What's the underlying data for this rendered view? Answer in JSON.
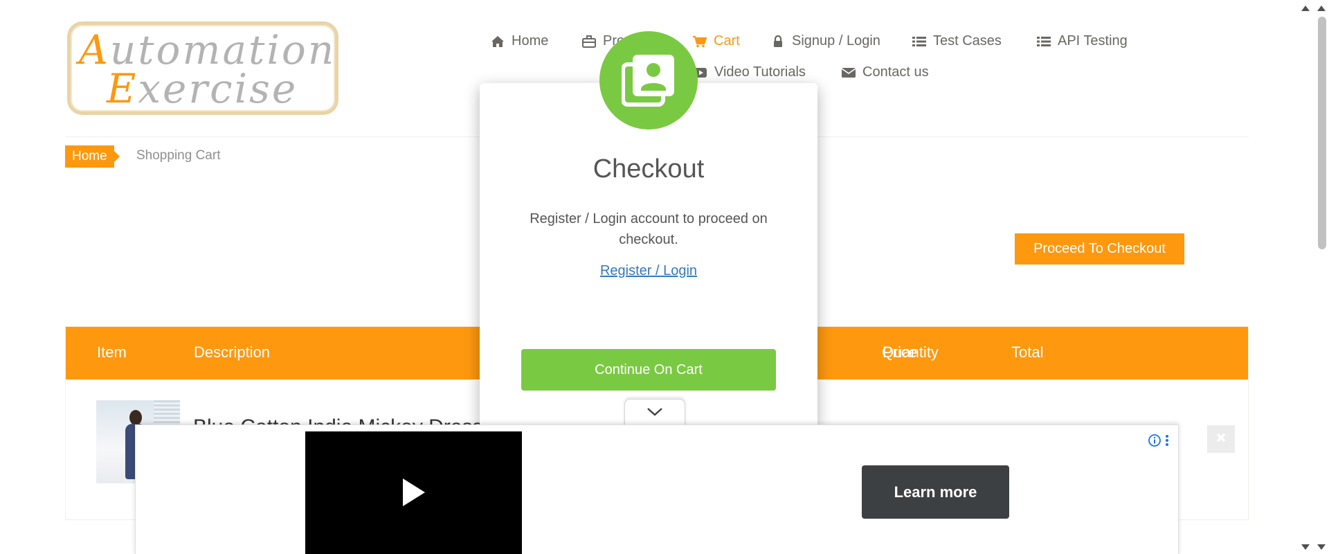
{
  "logo": {
    "line1_first": "A",
    "line1_rest": "utomation",
    "line2_first": "E",
    "line2_rest": "xercise"
  },
  "nav": {
    "items": [
      {
        "label": "Home",
        "icon": "home-icon"
      },
      {
        "label": "Products",
        "icon": "briefcase-icon"
      },
      {
        "label": "Cart",
        "icon": "shopping-cart-icon",
        "active": true
      },
      {
        "label": "Signup / Login",
        "icon": "lock-icon"
      },
      {
        "label": "Test Cases",
        "icon": "list-icon"
      },
      {
        "label": "API Testing",
        "icon": "list-icon"
      },
      {
        "label": "Video Tutorials",
        "icon": "youtube-play-icon"
      },
      {
        "label": "Contact us",
        "icon": "envelope-icon"
      }
    ]
  },
  "breadcrumb": {
    "home": "Home",
    "current": "Shopping Cart"
  },
  "cart": {
    "proceed_label": "Proceed To Checkout",
    "columns": [
      "Item",
      "Description",
      "Price",
      "Quantity",
      "Total"
    ],
    "rows": [
      {
        "description": "Blue Cotton Indie Mickey Dress"
      }
    ]
  },
  "modal": {
    "title": "Checkout",
    "body": "Register / Login account to proceed on checkout.",
    "link": "Register / Login",
    "continue_label": "Continue On Cart",
    "icon": "address-book-icon"
  },
  "ad": {
    "learn_more": "Learn more"
  },
  "colors": {
    "brand_orange": "#fe980f",
    "modal_green": "#7ac943",
    "link_blue": "#337ab7"
  }
}
